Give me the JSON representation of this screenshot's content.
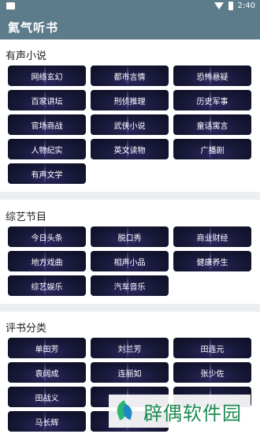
{
  "status": {
    "time": "2:40"
  },
  "app": {
    "title": "氦气听书"
  },
  "sections": [
    {
      "title": "有声小说",
      "items": [
        "网络玄幻",
        "都市言情",
        "恐怖悬疑",
        "百家讲坛",
        "刑侦推理",
        "历史军事",
        "官场商战",
        "武侠小说",
        "童话寓言",
        "人物纪实",
        "英文读物",
        "广播剧",
        "有声文学"
      ]
    },
    {
      "title": "综艺节目",
      "items": [
        "今日头条",
        "脱口秀",
        "商业财经",
        "地方戏曲",
        "相声小品",
        "健康养生",
        "综艺娱乐",
        "汽车音乐"
      ]
    },
    {
      "title": "评书分类",
      "items": [
        "单田芳",
        "刘兰芳",
        "田连元",
        "袁阔成",
        "连丽如",
        "张少佐",
        "田战义",
        "",
        "",
        "马长辉"
      ]
    }
  ],
  "watermark": {
    "text": "辟偶软件园"
  },
  "colors": {
    "appbar": "#5c7c8c",
    "tile": "#191a3c",
    "divider": "#eceff1"
  }
}
